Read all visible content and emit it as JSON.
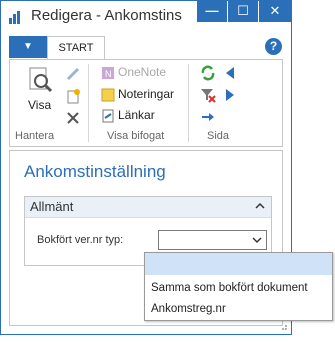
{
  "window": {
    "title": "Redigera - Ankomstinställning",
    "title_shown": "Redigera - Ankomstins",
    "controls": {
      "minimize": "—",
      "maximize": "☐",
      "close": "✕"
    }
  },
  "ribbon": {
    "tab_start": "START",
    "groups": {
      "hantera": {
        "label": "Hantera",
        "buttons": {
          "visa": "Visa"
        }
      },
      "visa_bifogat": {
        "label": "Visa bifogat",
        "buttons": {
          "onenote": "OneNote",
          "noteringar": "Noteringar",
          "lankar": "Länkar"
        }
      },
      "sida": {
        "label": "Sida"
      }
    }
  },
  "page": {
    "title": "Ankomstinställning",
    "section": {
      "title": "Allmänt",
      "field_label": "Bokfört ver.nr typ:",
      "field_value": ""
    }
  },
  "dropdown": {
    "options": [
      "",
      "Samma som bokfört dokument",
      "Ankomstreg.nr"
    ]
  },
  "colors": {
    "accent": "#2b6fb8",
    "selected": "#cfe2f7",
    "disabled_text": "#a8a8a8"
  }
}
